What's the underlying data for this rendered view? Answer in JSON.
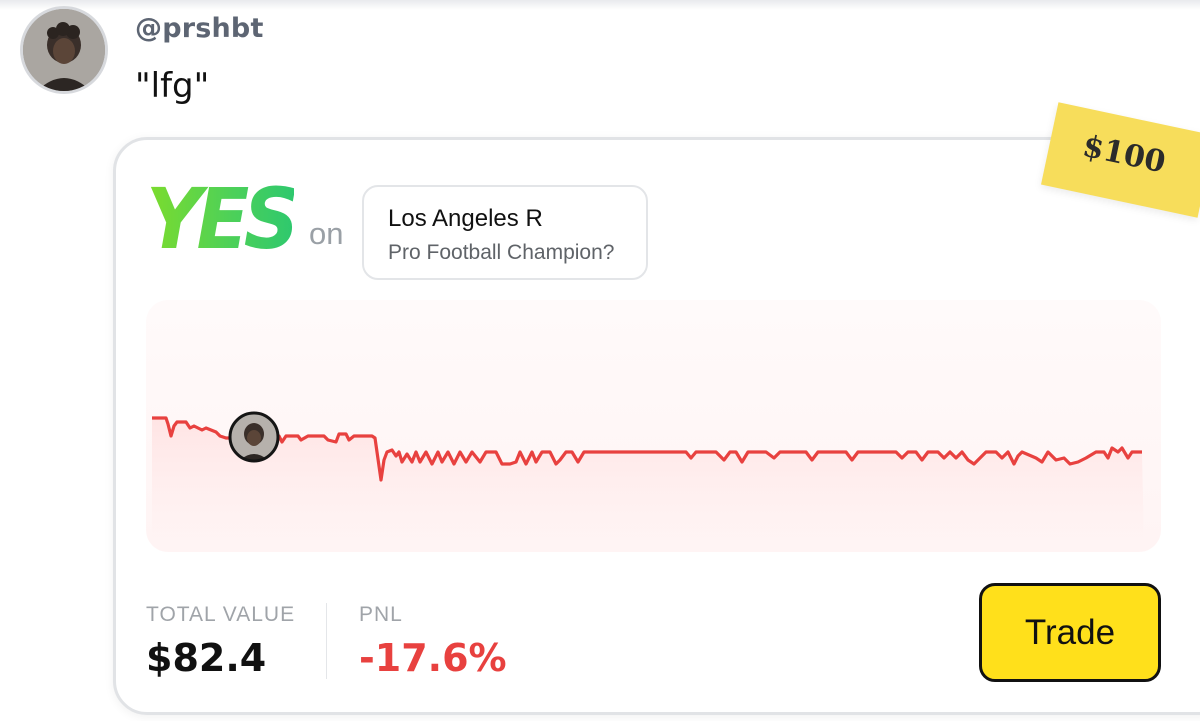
{
  "post": {
    "handle": "@prshbt",
    "message": "\"lfg\""
  },
  "card": {
    "side": "YES",
    "connector": "on",
    "market": {
      "title": "Los Angeles R",
      "subtitle": "Pro Football Champion?"
    },
    "tag": "$100",
    "stats": {
      "total_value_label": "TOTAL VALUE",
      "total_value": "$82.4",
      "pnl_label": "PNL",
      "pnl": "-17.6%"
    },
    "trade_label": "Trade"
  },
  "colors": {
    "yes_green": "#4fd157",
    "line_red": "#e8413f",
    "pnl_red": "#e8413f",
    "trade_yellow": "#ffe01b",
    "tag_yellow": "#f7dd5b"
  },
  "icons": {
    "avatar": "user-avatar",
    "chart_marker": "user-avatar-marker"
  }
}
